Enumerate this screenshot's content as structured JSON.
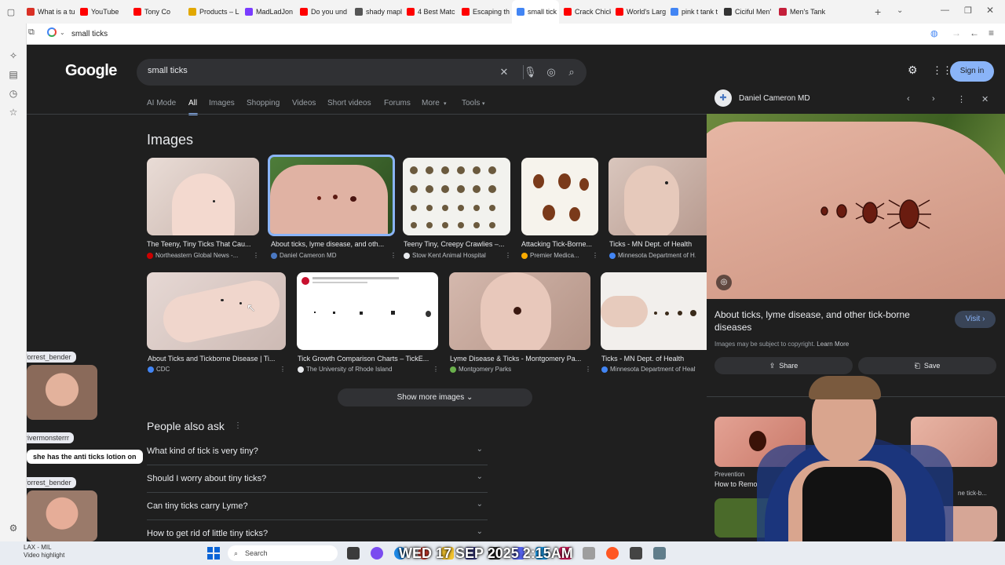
{
  "tabs": [
    {
      "label": "What is a tu",
      "color": "#d93025"
    },
    {
      "label": "YouTube",
      "color": "#ff0000"
    },
    {
      "label": "Tony Co",
      "color": "#ff0000"
    },
    {
      "label": "Products – L",
      "color": "#e2a800"
    },
    {
      "label": "MadLadJon",
      "color": "#7a3cff"
    },
    {
      "label": "Do you und",
      "color": "#ff0000"
    },
    {
      "label": "shady mapl",
      "color": "#555555"
    },
    {
      "label": "4 Best Matc",
      "color": "#ff0000"
    },
    {
      "label": "Escaping th",
      "color": "#ff0000"
    },
    {
      "label": "small tick",
      "color": "#4285f4",
      "active": true
    },
    {
      "label": "Crack Chick",
      "color": "#ff0000"
    },
    {
      "label": "World's Larg",
      "color": "#ff0000"
    },
    {
      "label": "pink t tank t",
      "color": "#4285f4"
    },
    {
      "label": "Ciciful Men'",
      "color": "#333333"
    },
    {
      "label": "Men's Tank",
      "color": "#c41e3a"
    }
  ],
  "address": {
    "value": "small ticks"
  },
  "google": {
    "logo": "Google",
    "query": "small ticks",
    "signin": "Sign in",
    "navtabs": [
      "AI Mode",
      "All",
      "Images",
      "Shopping",
      "Videos",
      "Short videos",
      "Forums",
      "More",
      "Tools"
    ],
    "images_title": "Images",
    "row1": [
      {
        "caption": "The Teeny, Tiny Ticks That Cau...",
        "source": "Northeastern Global News -...",
        "dot": "#cc0000"
      },
      {
        "caption": "About ticks, lyme disease, and oth...",
        "source": "Daniel Cameron MD",
        "dot": "#4a78c2"
      },
      {
        "caption": "Teeny Tiny, Creepy Crawlies –...",
        "source": "Stow Kent Animal Hospital",
        "dot": "#e8eaed"
      },
      {
        "caption": "Attacking Tick-Borne...",
        "source": "Premier Medica...",
        "dot": "#f9ab00"
      },
      {
        "caption": "Ticks - MN Dept. of Health",
        "source": "Minnesota Department of H...",
        "dot": "#4285f4"
      }
    ],
    "row2": [
      {
        "caption": "About Ticks and Tickborne Disease | Ti...",
        "source": "CDC",
        "dot": "#4285f4"
      },
      {
        "caption": "Tick Growth Comparison Charts – TickE...",
        "source": "The University of Rhode Island",
        "dot": "#e8eaed"
      },
      {
        "caption": "Lyme Disease & Ticks - Montgomery Pa...",
        "source": "Montgomery Parks",
        "dot": "#6ab04c"
      },
      {
        "caption": "Ticks - MN Dept. of Health",
        "source": "Minnesota Department of Health",
        "dot": "#4285f4"
      }
    ],
    "show_more": "Show more images",
    "paa_title": "People also ask",
    "paa": [
      "What kind of tick is very tiny?",
      "Should I worry about tiny ticks?",
      "Can tiny ticks carry Lyme?",
      "How to get rid of little tiny ticks?"
    ]
  },
  "panel": {
    "source": "Daniel Cameron MD",
    "title": "About ticks, lyme disease, and other tick-borne diseases",
    "visit": "Visit",
    "copyright": "Images may be subject to copyright.",
    "learn_more": "Learn More",
    "share": "Share",
    "save": "Save",
    "related1_source": "Prevention",
    "related1_caption": "How to Remo",
    "related2_caption": "ne tick-b..."
  },
  "stream": {
    "chat": [
      {
        "user": "forrest_bender"
      },
      {
        "user": "rivermonsterrr",
        "message": "she has the anti ticks lotion on"
      },
      {
        "user": "forrest_bender"
      }
    ],
    "overlay_text": "WED 17 SEP 2025 2:15AM",
    "video_highlight_title": "LAX - MIL",
    "video_highlight_label": "Video highlight"
  },
  "taskbar": {
    "search": "Search"
  }
}
